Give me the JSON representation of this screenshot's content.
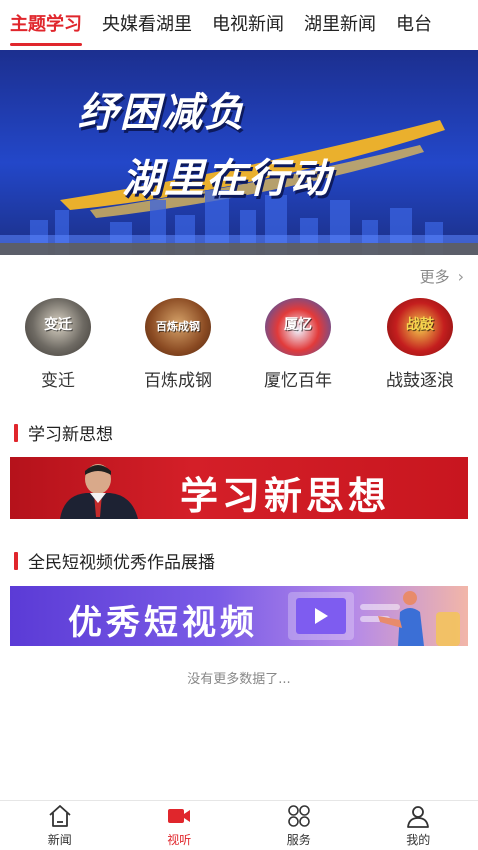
{
  "tabs": [
    "主题学习",
    "央媒看湖里",
    "电视新闻",
    "湖里新闻",
    "电台"
  ],
  "banner": {
    "line1": "纾困减负",
    "line2": "湖里在行动"
  },
  "more_label": "更多",
  "topics": [
    {
      "label": "变迁",
      "thumb_text": "变迁"
    },
    {
      "label": "百炼成钢",
      "thumb_text": "百炼成钢"
    },
    {
      "label": "厦忆百年",
      "thumb_text": "厦忆"
    },
    {
      "label": "战鼓逐浪",
      "thumb_text": "战鼓"
    }
  ],
  "sections": {
    "study_title": "学习新思想",
    "study_banner_text": "学习新思想",
    "video_title": "全民短视频优秀作品展播",
    "video_banner_text": "优秀短视频"
  },
  "no_more": "没有更多数据了...",
  "nav": [
    {
      "label": "新闻",
      "icon": "home-icon"
    },
    {
      "label": "视听",
      "icon": "video-camera-icon"
    },
    {
      "label": "服务",
      "icon": "grid-icon"
    },
    {
      "label": "我的",
      "icon": "user-icon"
    }
  ],
  "colors": {
    "accent": "#e0262c"
  }
}
